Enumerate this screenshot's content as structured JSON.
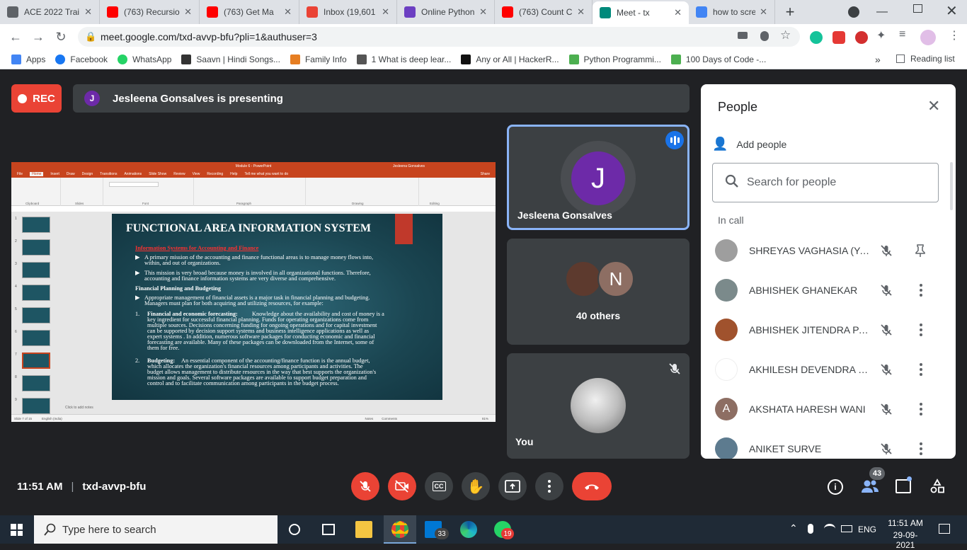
{
  "browser": {
    "tabs": [
      {
        "title": "ACE 2022 Trai",
        "icon": "doc-icon",
        "color": "#5f6368"
      },
      {
        "title": "(763) Recursio",
        "icon": "youtube-icon",
        "color": "#ff0000"
      },
      {
        "title": "(763) Get Ma",
        "icon": "youtube-icon",
        "color": "#ff0000"
      },
      {
        "title": "Inbox (19,601",
        "icon": "gmail-icon",
        "color": "#ea4335"
      },
      {
        "title": "Online Python",
        "icon": "bolt-icon",
        "color": "#6c3fc2"
      },
      {
        "title": "(763) Count C",
        "icon": "youtube-icon",
        "color": "#ff0000"
      },
      {
        "title": "Meet - tx",
        "icon": "meet-icon",
        "color": "#00897b"
      },
      {
        "title": "how to screen",
        "icon": "google-icon",
        "color": "#4285f4"
      }
    ],
    "url": "meet.google.com/txd-avvp-bfu?pli=1&authuser=3",
    "bookmarks": [
      {
        "label": "Apps",
        "icon": "apps-grid-icon"
      },
      {
        "label": "Facebook",
        "icon": "facebook-icon"
      },
      {
        "label": "WhatsApp",
        "icon": "whatsapp-icon"
      },
      {
        "label": "Saavn | Hindi Songs...",
        "icon": "saavn-icon"
      },
      {
        "label": "Family Info",
        "icon": "family-icon"
      },
      {
        "label": "1 What is deep lear...",
        "icon": "page-icon"
      },
      {
        "label": "Any or All | HackerR...",
        "icon": "hackerrank-icon"
      },
      {
        "label": "Python Programmi...",
        "icon": "bookmark-icon"
      },
      {
        "label": "100 Days of Code -...",
        "icon": "bookmark-icon"
      }
    ],
    "more_bookmarks": "»",
    "reading_list": "Reading list"
  },
  "meet": {
    "rec_label": "REC",
    "presenter_initial": "J",
    "presenting_text": "Jesleena Gonsalves is presenting",
    "tiles": [
      {
        "name": "Jesleena Gonsalves",
        "initial": "J"
      },
      {
        "name": "40 others",
        "initial": "N"
      },
      {
        "name": "You"
      }
    ],
    "people_panel": {
      "title": "People",
      "add_people": "Add people",
      "search_placeholder": "Search for people",
      "section": "In call",
      "participants": [
        {
          "name": "SHREYAS VAGHASIA (You)",
          "avatar_color": "#9e9e9e"
        },
        {
          "name": "ABHISHEK GHANEKAR",
          "avatar_color": "#7b8a8b"
        },
        {
          "name": "ABHISHEK JITENDRA PAR...",
          "avatar_color": "#a0522d"
        },
        {
          "name": "AKHILESH DEVENDRA NE...",
          "avatar_color": "#ffffff"
        },
        {
          "name": "AKSHATA HARESH WANI",
          "avatar_color": "#8d6e63",
          "initial": "A"
        },
        {
          "name": "ANIKET SURVE",
          "avatar_color": "#5d7b8f"
        }
      ]
    },
    "time": "11:51 AM",
    "meeting_code": "txd-avvp-bfu",
    "people_count": "43"
  },
  "slide": {
    "window_title": "Module 6 - PowerPoint",
    "user": "Jesleena Gonsalves",
    "menu": [
      "File",
      "Home",
      "Insert",
      "Draw",
      "Design",
      "Transitions",
      "Animations",
      "Slide Show",
      "Review",
      "View",
      "Recording",
      "Help",
      "Tell me what you want to do"
    ],
    "share": "Share",
    "ribbon_groups": [
      "Clipboard",
      "Slides",
      "Font",
      "Paragraph",
      "Drawing",
      "Editing"
    ],
    "title": "FUNCTIONAL AREA INFORMATION SYSTEM",
    "heading1": "Information Systems for Accounting and Finance",
    "bullet1_l1": "A primary mission of the accounting and finance functional areas is to manage money flows into,",
    "bullet1_l2": "within, and out of organizations.",
    "bullet2_l1": "This mission is very broad because money is involved in all organizational functions. Therefore,",
    "bullet2_l2": "accounting and finance information systems are very diverse and comprehensive.",
    "heading2": "Financial Planning and Budgeting",
    "bullet3_l1": "Appropriate management of financial assets is a major task in financial planning and budgeting.",
    "bullet3_l2": "Managers must plan for both acquiring and utilizing resources, for example:",
    "item1_label": "Financial and economic forecasting:",
    "item1_l1": "Knowledge about the availability and cost of money is a",
    "item1_l2": "key ingredient for successful financial planning.  Funds for operating organizations come from",
    "item1_l3": "multiple sources. Decisions concerning funding for ongoing operations and for capital investment",
    "item1_l4": "can be supported by decision support systems and business intelligence applications as well as",
    "item1_l5": "expert systems . In addition, numerous software packages for conducting economic and financial",
    "item1_l6": "forecasting are available. Many of these packages can be downloaded from the Internet, some of",
    "item1_l7": "them for free.",
    "item2_label": "Budgeting:",
    "item2_l1": "An essential component of the accounting/finance function is the annual budget,",
    "item2_l2": "which allocates the organization's financial resources among participants and activities. The",
    "item2_l3": "budget allows management to distribute resources in the way that best supports the organization's",
    "item2_l4": "mission and goals. Several software packages are available to support budget preparation and",
    "item2_l5": "control and to facilitate communication among participants in the budget process.",
    "notes_placeholder": "Click to add notes",
    "status_left": "Slide 7 of 15",
    "status_lang": "English (India)",
    "status_notes": "Notes",
    "status_comments": "Comments",
    "zoom": "81%",
    "thumb_numbers": [
      "1",
      "2",
      "3",
      "4",
      "5",
      "6",
      "7",
      "8",
      "9"
    ]
  },
  "taskbar": {
    "search_placeholder": "Type here to search",
    "mail_badge": "33",
    "whatsapp_badge": "19",
    "lang": "ENG",
    "time": "11:51 AM",
    "date": "29-09-2021"
  }
}
